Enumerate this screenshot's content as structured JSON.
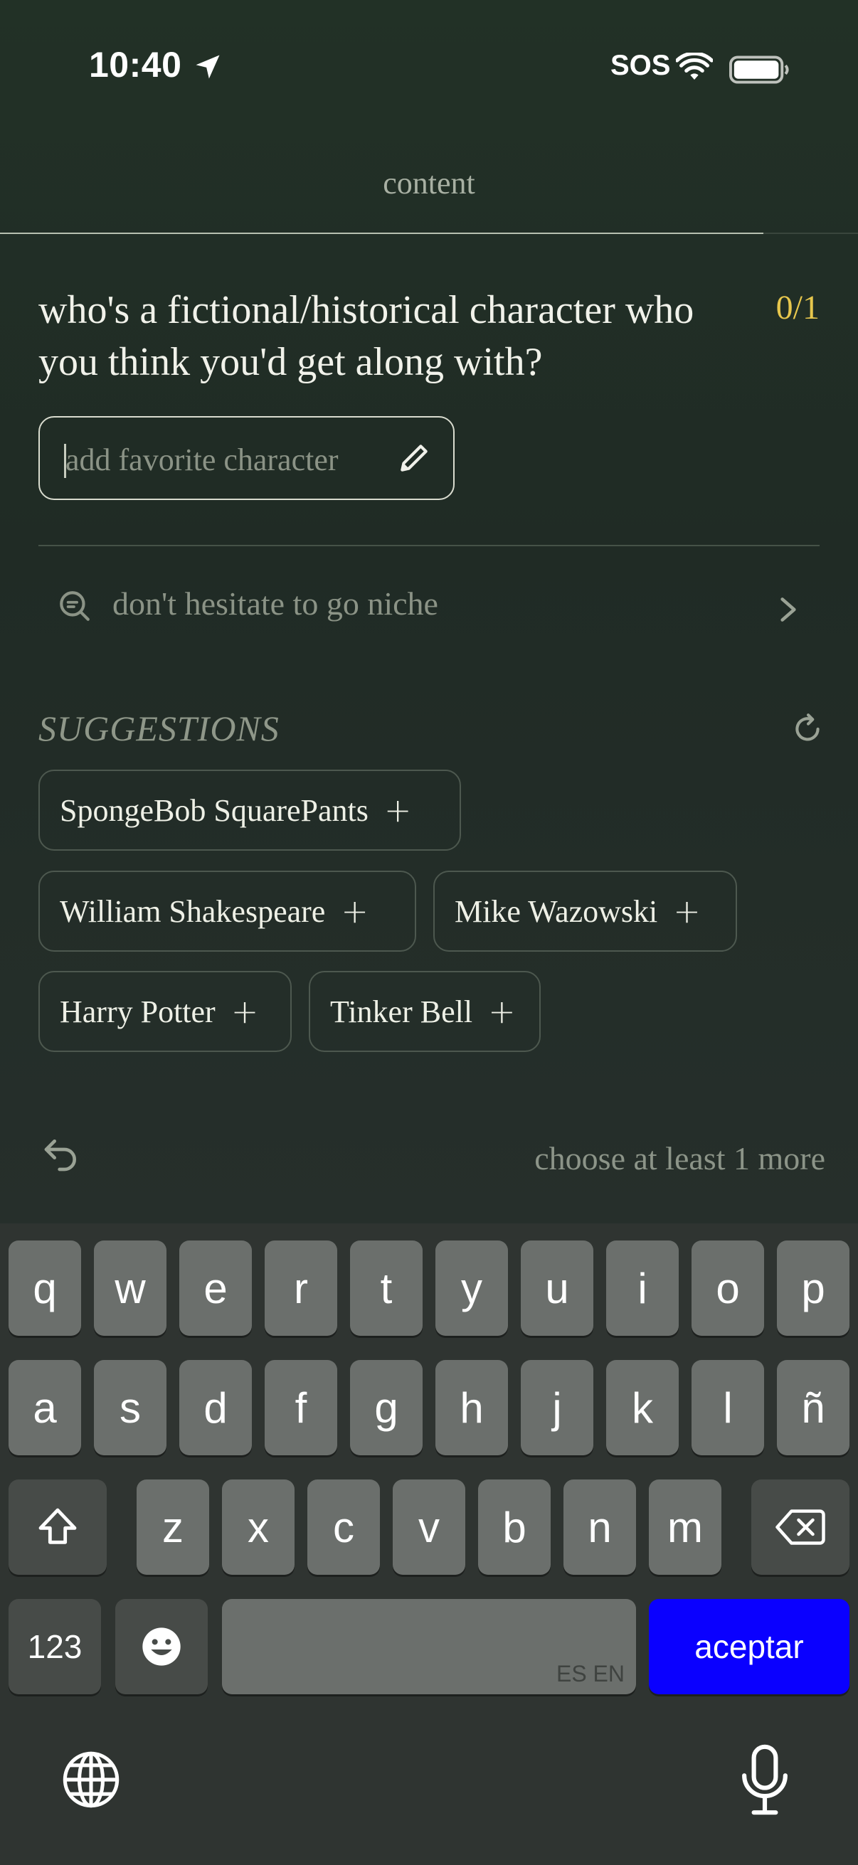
{
  "status_bar": {
    "time": "10:40",
    "sos": "SOS"
  },
  "nav": {
    "title": "content",
    "progress": 0.89
  },
  "question": {
    "text": "who's a fictional/historical character who you think you'd get along with?",
    "counter": "0/1"
  },
  "input": {
    "placeholder": "add favorite character"
  },
  "tip": {
    "text": "don't hesitate to go niche"
  },
  "suggestions": {
    "title": "SUGGESTIONS",
    "items": [
      "SpongeBob SquarePants",
      "William Shakespeare",
      "Mike Wazowski",
      "Harry Potter",
      "Tinker Bell"
    ],
    "add_symbol": "+"
  },
  "footer": {
    "hint": "choose at least 1 more"
  },
  "keyboard": {
    "row1": [
      "q",
      "w",
      "e",
      "r",
      "t",
      "y",
      "u",
      "i",
      "o",
      "p"
    ],
    "row2": [
      "a",
      "s",
      "d",
      "f",
      "g",
      "h",
      "j",
      "k",
      "l",
      "ñ"
    ],
    "row3": [
      "z",
      "x",
      "c",
      "v",
      "b",
      "n",
      "m"
    ],
    "numbers_label": "123",
    "space_languages": "ES EN",
    "accept_label": "aceptar"
  },
  "colors": {
    "accent_yellow": "#e7c74d",
    "accept_blue": "#0a00ff"
  }
}
